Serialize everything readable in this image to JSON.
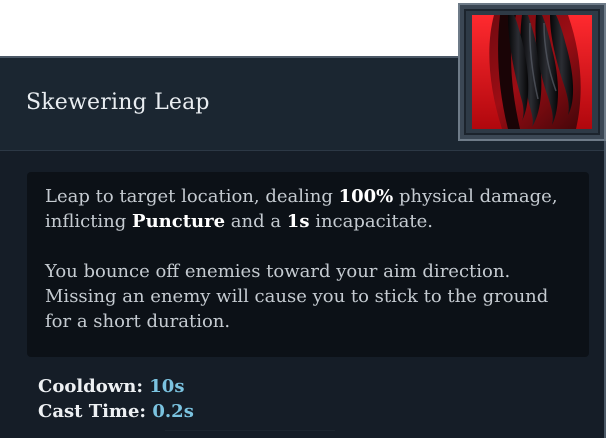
{
  "ability": {
    "title": "Skewering Leap",
    "icon": "red-claw-talon-icon",
    "description": {
      "p1": {
        "t1": "Leap to target location, dealing ",
        "h1": "100%",
        "t2": " physical damage, inflicting ",
        "h2": "Puncture",
        "t3": " and a ",
        "h3": "1s",
        "t4": " incapacitate."
      },
      "p2": "You bounce off enemies toward your aim direction. Missing an enemy will cause you to stick to the ground for a short duration."
    },
    "stats": {
      "cooldown_label": "Cooldown:",
      "cooldown_value": "10s",
      "cast_time_label": "Cast Time:",
      "cast_time_value": "0.2s"
    }
  },
  "colors": {
    "panel_bg": "#151d27",
    "header_bg": "#1b2631",
    "desc_bg": "#0c1117",
    "highlight": "#ffffff",
    "stat_value": "#7bc3e0",
    "icon_red": "#d3141c"
  }
}
